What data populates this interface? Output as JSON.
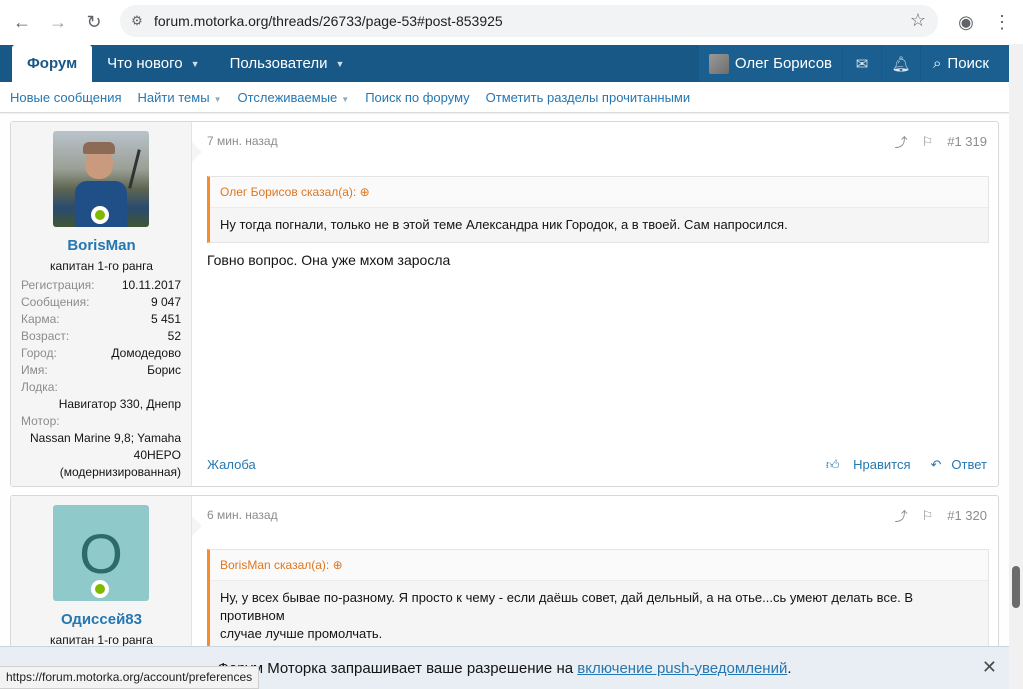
{
  "browser": {
    "url": "forum.motorka.org/threads/26733/page-53#post-853925",
    "status_url": "https://forum.motorka.org/account/preferences"
  },
  "nav": {
    "tabs": [
      {
        "label": "Форум"
      },
      {
        "label": "Что нового"
      },
      {
        "label": "Пользователи"
      }
    ],
    "user_name": "Олег Борисов",
    "search_label": "Поиск"
  },
  "subnav": {
    "items": [
      {
        "label": "Новые сообщения"
      },
      {
        "label": "Найти темы"
      },
      {
        "label": "Отслеживаемые"
      },
      {
        "label": "Поиск по форуму"
      },
      {
        "label": "Отметить разделы прочитанными"
      }
    ]
  },
  "posts": [
    {
      "author": "BorisMan",
      "rank": "капитан 1-го ранга",
      "stats": [
        {
          "label": "Регистрация:",
          "value": "10.11.2017"
        },
        {
          "label": "Сообщения:",
          "value": "9 047"
        },
        {
          "label": "Карма:",
          "value": "5 451"
        },
        {
          "label": "Возраст:",
          "value": "52"
        },
        {
          "label": "Город:",
          "value": "Домодедово"
        },
        {
          "label": "Имя:",
          "value": "Борис"
        }
      ],
      "boat_label": "Лодка:",
      "boat_value": "Навигатор 330, Днепр",
      "motor_label": "Мотор:",
      "motor_value_1": "Nassan Marine 9,8; Yamaha",
      "motor_value_2": "40HEPO",
      "motor_value_3": "(модернизированная)",
      "time": "7 мин. назад",
      "number": "#1 319",
      "quote_author": "Олег Борисов сказал(а):",
      "quote_text": "Ну тогда погнали, только не в этой теме Александра ник Городок, а в твоей. Сам напросился.",
      "message": "Говно вопрос. Она уже мхом заросла",
      "report": "Жалоба",
      "like": "Нравится",
      "reply": "Ответ"
    },
    {
      "author": "Одиссей83",
      "avatar_letter": "О",
      "rank": "капитан 1-го ранга",
      "time": "6 мин. назад",
      "number": "#1 320",
      "quote_author": "BorisMan сказал(а):",
      "quote_text_1": "Ну, у всех бывае по-разному. Я просто к чему - если даёшь совет, дай дельный, а на отье...сь умеют делать все. В противном",
      "quote_text_2": "случае лучше промолчать."
    }
  ],
  "push_banner": {
    "text": "Форум Моторка запрашивает ваше разрешение на ",
    "link": "включение push-уведомлений",
    "end": "."
  },
  "colors": {
    "nav_bg": "#185886",
    "link": "#2577b1",
    "quote_accent": "#f78c28",
    "online": "#7fb900"
  }
}
